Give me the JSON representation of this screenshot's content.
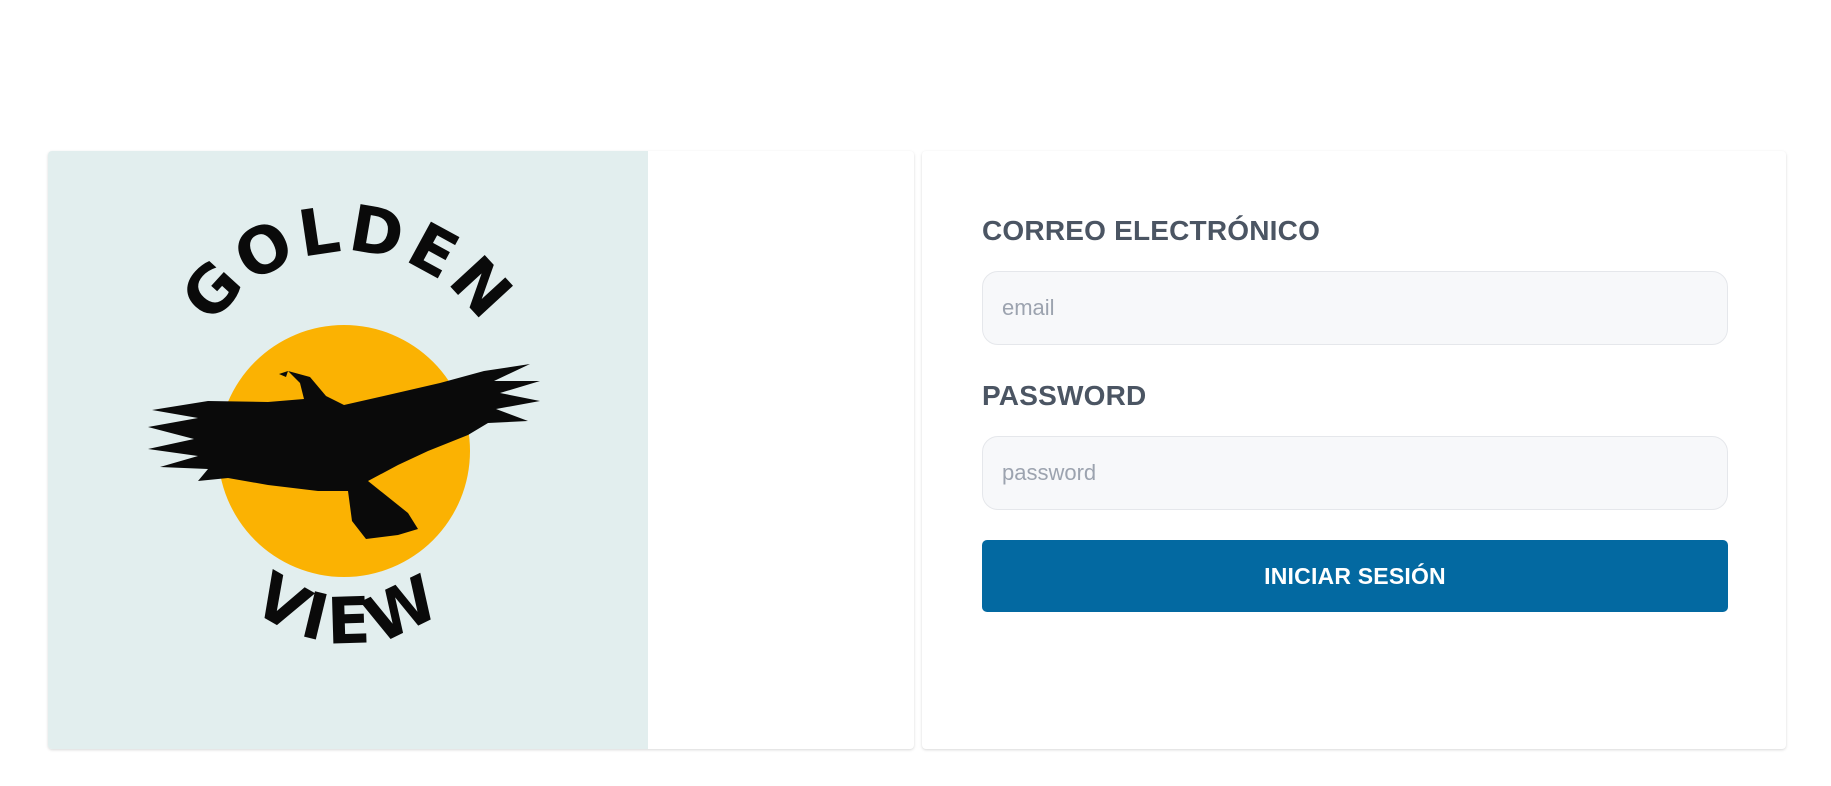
{
  "logo": {
    "name": "eagle-sun-logo",
    "text_top": "GOLDEN",
    "text_bottom": "VIEW",
    "colors": {
      "panel_background": "#e2eeee",
      "sun": "#fbb202",
      "bird_and_text": "#0a0a0a"
    }
  },
  "form": {
    "email": {
      "label": "CORREO ELECTRÓNICO",
      "placeholder": "email",
      "value": ""
    },
    "password": {
      "label": "PASSWORD",
      "placeholder": "password",
      "value": ""
    },
    "submit_label": "INICIAR SESIÓN"
  },
  "colors": {
    "page_background": "#ffffff",
    "label_text": "#4b5563",
    "input_background": "#f7f8fa",
    "input_border": "#e5e7eb",
    "primary_button": "#0369a1",
    "button_text": "#ffffff"
  }
}
